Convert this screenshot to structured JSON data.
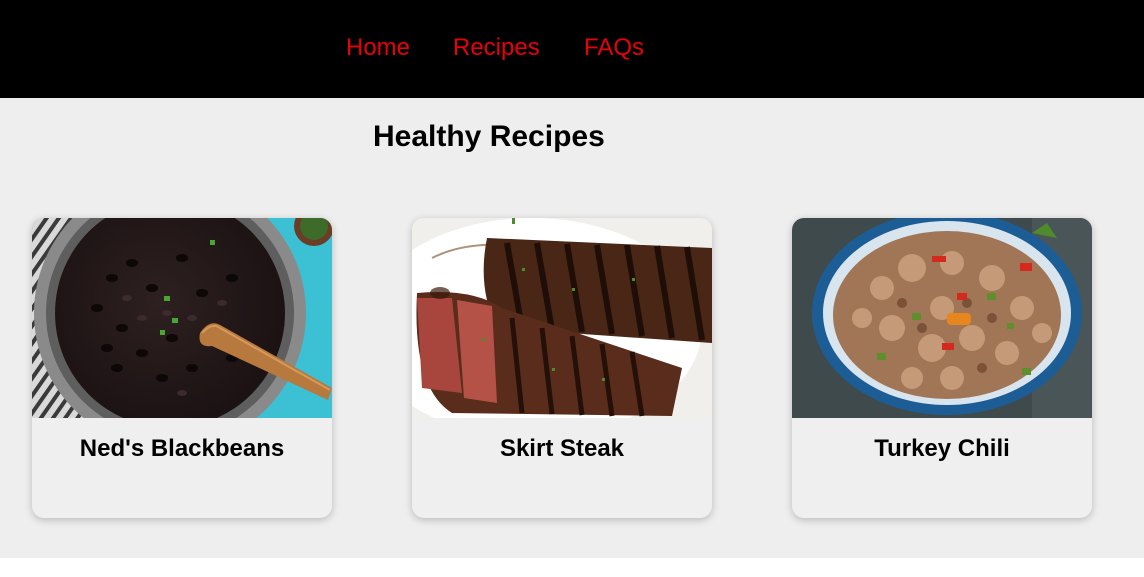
{
  "nav": {
    "links": [
      {
        "label": "Home"
      },
      {
        "label": "Recipes"
      },
      {
        "label": "FAQs"
      }
    ],
    "link_color": "#e8000b",
    "background": "#000000"
  },
  "page": {
    "title": "Healthy Recipes",
    "background": "#eeeeee"
  },
  "recipes": [
    {
      "title": "Ned's Blackbeans",
      "image": "black beans in pot with wooden spoon"
    },
    {
      "title": "Skirt Steak",
      "image": "grilled sliced skirt steak on plate"
    },
    {
      "title": "Turkey Chili",
      "image": "ground turkey chili in blue bowl"
    }
  ]
}
